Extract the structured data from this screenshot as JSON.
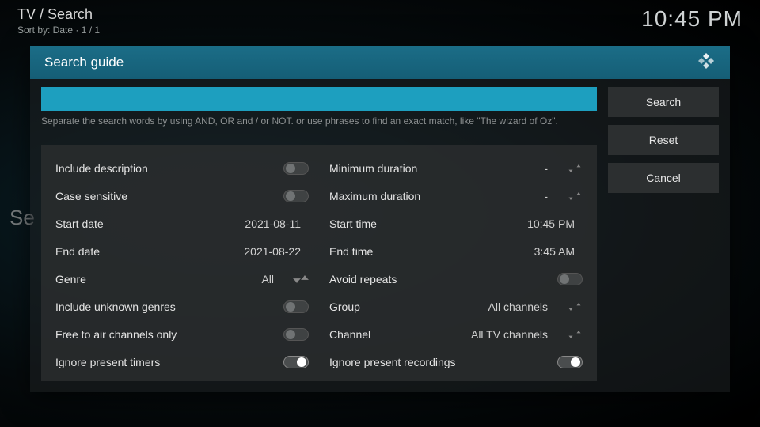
{
  "header": {
    "breadcrumb": "TV / Search",
    "sort_label": "Sort by: Date  ·  1 / 1",
    "clock": "10:45 PM"
  },
  "bg_text": "Se",
  "dialog": {
    "title": "Search guide",
    "search_value": "",
    "hint": "Separate the search words by using AND, OR and / or NOT. or use phrases to find an exact match, like \"The wizard of Oz\".",
    "buttons": {
      "search": "Search",
      "reset": "Reset",
      "cancel": "Cancel"
    },
    "left": {
      "include_description": {
        "label": "Include description",
        "on": false
      },
      "case_sensitive": {
        "label": "Case sensitive",
        "on": false
      },
      "start_date": {
        "label": "Start date",
        "value": "2021-08-11"
      },
      "end_date": {
        "label": "End date",
        "value": "2021-08-22"
      },
      "genre": {
        "label": "Genre",
        "value": "All"
      },
      "include_unknown_genres": {
        "label": "Include unknown genres",
        "on": false
      },
      "free_to_air": {
        "label": "Free to air channels only",
        "on": false
      },
      "ignore_present_timers": {
        "label": "Ignore present timers",
        "on": true
      }
    },
    "right": {
      "min_duration": {
        "label": "Minimum duration",
        "value": "-"
      },
      "max_duration": {
        "label": "Maximum duration",
        "value": "-"
      },
      "start_time": {
        "label": "Start time",
        "value": "10:45 PM"
      },
      "end_time": {
        "label": "End time",
        "value": "3:45 AM"
      },
      "avoid_repeats": {
        "label": "Avoid repeats",
        "on": false
      },
      "group": {
        "label": "Group",
        "value": "All channels"
      },
      "channel": {
        "label": "Channel",
        "value": "All TV channels"
      },
      "ignore_present_recordings": {
        "label": "Ignore present recordings",
        "on": true
      }
    }
  }
}
